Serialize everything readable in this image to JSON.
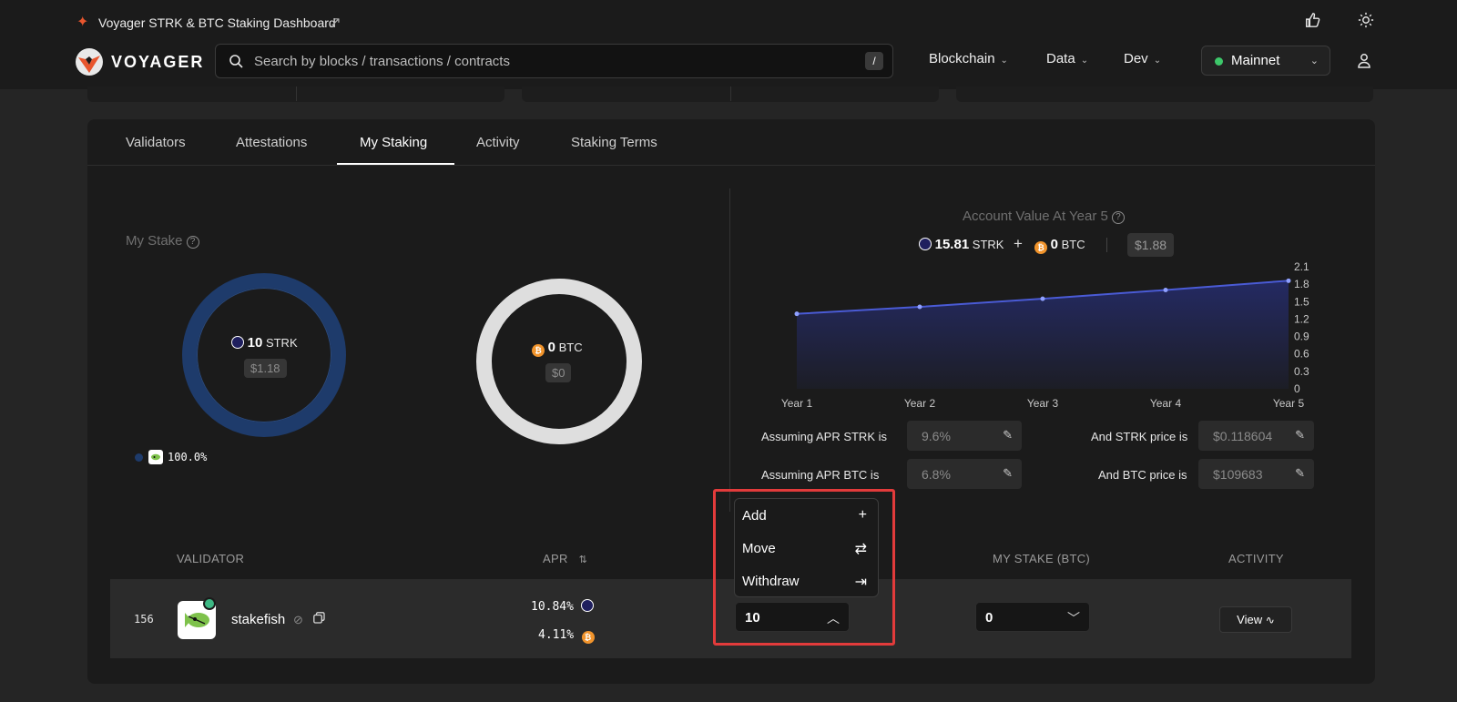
{
  "banner": {
    "title": "Voyager STRK & BTC Staking Dashboard"
  },
  "header": {
    "logo_text": "VOYAGER",
    "search_placeholder": "Search by blocks / transactions / contracts",
    "search_shortcut": "/",
    "nav": [
      "Blockchain",
      "Data",
      "Dev"
    ],
    "network": "Mainnet"
  },
  "tabs": [
    "Validators",
    "Attestations",
    "My Staking",
    "Activity",
    "Staking Terms"
  ],
  "active_tab": "My Staking",
  "my_stake": {
    "title": "My Stake",
    "strk_amount": "10",
    "strk_unit": "STRK",
    "strk_usd": "$1.18",
    "btc_amount": "0",
    "btc_unit": "BTC",
    "btc_usd": "$0",
    "legend_pct": "100.0%"
  },
  "account_value": {
    "title": "Account Value At Year 5",
    "strk_amount": "15.81",
    "strk_unit": "STRK",
    "plus": "+",
    "btc_amount": "0",
    "btc_unit": "BTC",
    "usd": "$1.88"
  },
  "chart_data": {
    "type": "area",
    "categories": [
      "Year 1",
      "Year 2",
      "Year 3",
      "Year 4",
      "Year 5"
    ],
    "values": [
      1.29,
      1.41,
      1.55,
      1.7,
      1.86
    ],
    "y_ticks": [
      "2.1",
      "1.8",
      "1.5",
      "1.2",
      "0.9",
      "0.6",
      "0.3",
      "0"
    ],
    "ylim": [
      0,
      2.1
    ],
    "line_color": "#4a5bd6",
    "fill_color": "#242a63"
  },
  "assumptions": {
    "apr_strk_label": "Assuming APR STRK is",
    "apr_strk": "9.6%",
    "apr_btc_label": "Assuming APR BTC is",
    "apr_btc": "6.8%",
    "strk_price_label": "And STRK price is",
    "strk_price": "$0.118604",
    "btc_price_label": "And BTC price is",
    "btc_price": "$109683"
  },
  "table": {
    "headers": {
      "validator": "VALIDATOR",
      "apr": "APR",
      "my_stake_btc": "MY STAKE (BTC)",
      "activity": "ACTIVITY"
    },
    "row": {
      "rank": "156",
      "name": "stakefish",
      "apr_strk": "10.84%",
      "apr_btc": "4.11%",
      "stake_strk": "10",
      "stake_btc": "0",
      "view_label": "View"
    }
  },
  "dropdown": [
    "Add",
    "Move",
    "Withdraw"
  ],
  "colors": {
    "accent_highlight": "#e23b3b",
    "online": "#3dc76a",
    "strk_ring": "#1e3b6b",
    "btc": "#f1942c"
  }
}
